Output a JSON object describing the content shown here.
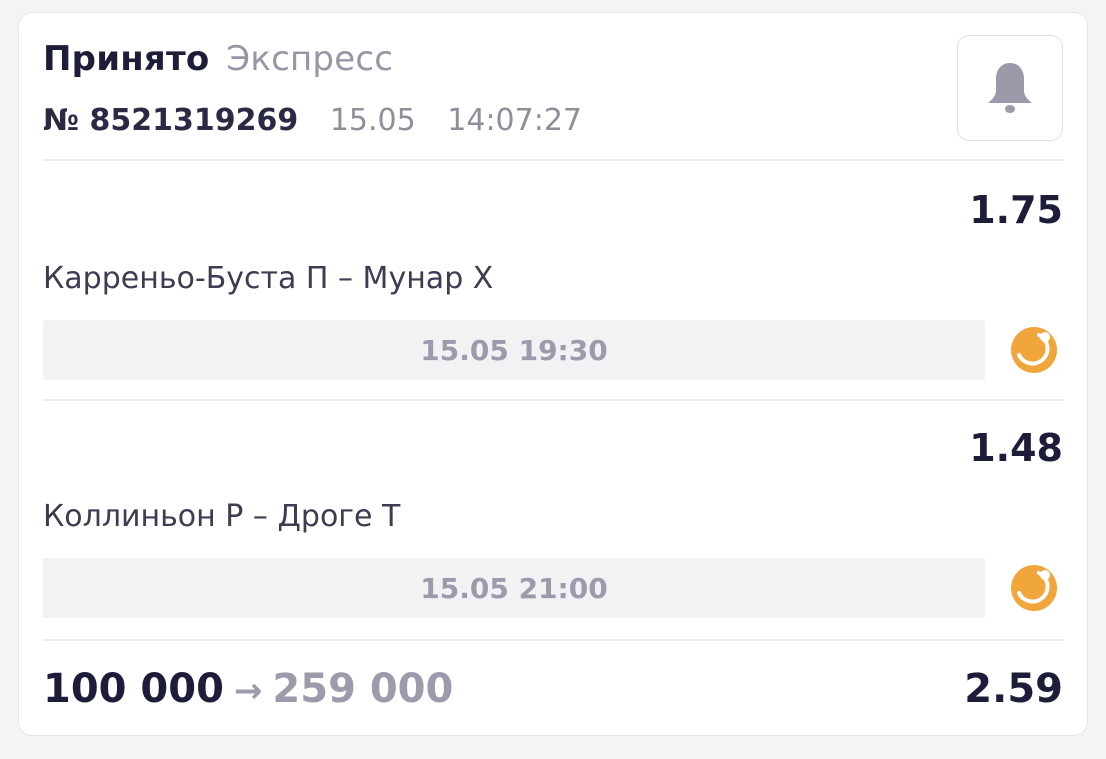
{
  "bet": {
    "status": "Принято",
    "type": "Экспресс",
    "number": "№ 8521319269",
    "date": "15.05",
    "time": "14:07:27",
    "bell_icon": "bell-icon"
  },
  "events": [
    {
      "odd": "1.75",
      "teams": "Карреньо-Буста П – Мунар Х",
      "start": "15.05 19:30",
      "sport_icon": "tennis-ball-icon"
    },
    {
      "odd": "1.48",
      "teams": "Коллиньон Р – Дроге Т",
      "start": "15.05 21:00",
      "sport_icon": "tennis-ball-icon"
    }
  ],
  "footer": {
    "stake": "100 000",
    "arrow": "→",
    "payout": "259 000",
    "total_odd": "2.59"
  },
  "colors": {
    "primary_text": "#1d1d3a",
    "secondary_text": "#9696a6",
    "accent_orange": "#f0a63a",
    "bell_gray": "#9a9aaa"
  }
}
